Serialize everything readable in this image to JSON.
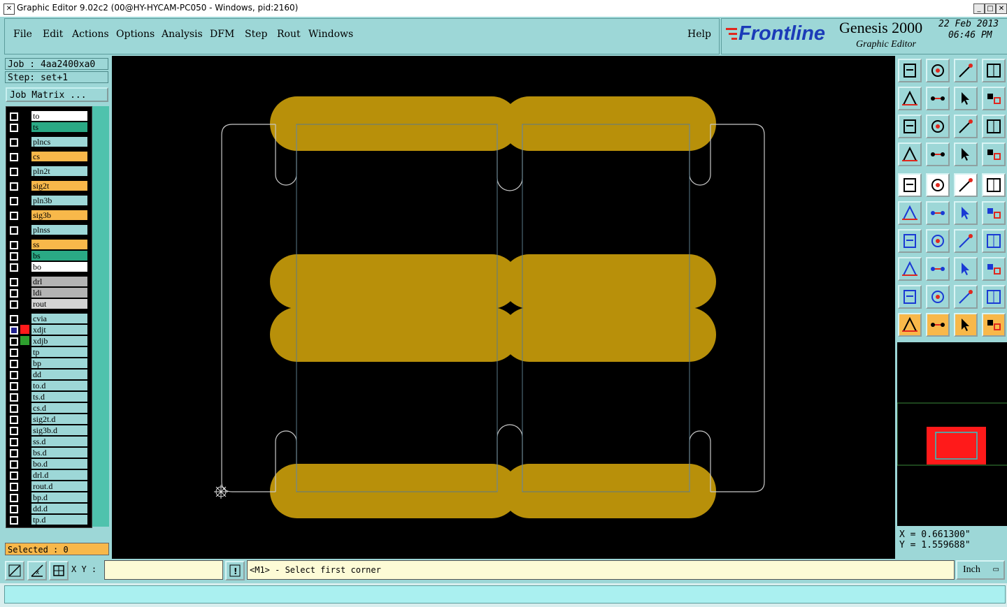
{
  "window": {
    "title": "Graphic Editor 9.02c2 (00@HY-HYCAM-PC050 - Windows, pid:2160)",
    "min": "_",
    "max": "□",
    "close": "✕"
  },
  "menu": {
    "items": [
      "File",
      "Edit",
      "Actions",
      "Options",
      "Analysis",
      "DFM",
      "Step",
      "Rout",
      "Windows"
    ],
    "help": "Help"
  },
  "brand": {
    "logo": "Frontline",
    "product": "Genesis 2000",
    "subtitle": "Graphic Editor",
    "date": "22 Feb 2013",
    "time": "06:46 PM"
  },
  "job": {
    "job_label": "Job : 4aa2400xa0",
    "step_label": "Step: set+1",
    "matrix_button": "Job Matrix ..."
  },
  "layers": [
    {
      "name": "to",
      "color": "#ffffff"
    },
    {
      "name": "ts",
      "color": "#2aa985"
    },
    {
      "name": "plncs",
      "color": "#9dd7d7"
    },
    {
      "name": "cs",
      "color": "#f8b84a"
    },
    {
      "name": "pln2t",
      "color": "#9dd7d7"
    },
    {
      "name": "sig2t",
      "color": "#f8b84a"
    },
    {
      "name": "pln3b",
      "color": "#9dd7d7"
    },
    {
      "name": "sig3b",
      "color": "#f8b84a"
    },
    {
      "name": "plnss",
      "color": "#9dd7d7"
    },
    {
      "name": "ss",
      "color": "#f8b84a"
    },
    {
      "name": "bs",
      "color": "#2aa985"
    },
    {
      "name": "bo",
      "color": "#ffffff"
    },
    {
      "name": "drl",
      "color": "#b4b4b4"
    },
    {
      "name": "ldi",
      "color": "#b4b4b4"
    },
    {
      "name": "rout",
      "color": "#d4d4d4"
    },
    {
      "name": "cvia",
      "color": "#9dd7d7"
    },
    {
      "name": "xdjt",
      "color": "#9dd7d7"
    },
    {
      "name": "xdjb",
      "color": "#9dd7d7"
    },
    {
      "name": "tp",
      "color": "#9dd7d7"
    },
    {
      "name": "bp",
      "color": "#9dd7d7"
    },
    {
      "name": "dd",
      "color": "#9dd7d7"
    },
    {
      "name": "to.d",
      "color": "#9dd7d7"
    },
    {
      "name": "ts.d",
      "color": "#9dd7d7"
    },
    {
      "name": "cs.d",
      "color": "#9dd7d7"
    },
    {
      "name": "sig2t.d",
      "color": "#9dd7d7"
    },
    {
      "name": "sig3b.d",
      "color": "#9dd7d7"
    },
    {
      "name": "ss.d",
      "color": "#9dd7d7"
    },
    {
      "name": "bs.d",
      "color": "#9dd7d7"
    },
    {
      "name": "bo.d",
      "color": "#9dd7d7"
    },
    {
      "name": "drl.d",
      "color": "#9dd7d7"
    },
    {
      "name": "rout.d",
      "color": "#9dd7d7"
    },
    {
      "name": "bp.d",
      "color": "#9dd7d7"
    },
    {
      "name": "dd.d",
      "color": "#9dd7d7"
    },
    {
      "name": "tp.d",
      "color": "#9dd7d7"
    }
  ],
  "selected": "Selected : 0",
  "coords": {
    "x": "X = 0.661300\"",
    "y": "Y = 1.559688\""
  },
  "bottom": {
    "xy_label": "X Y :",
    "xy_value": "",
    "prompt": "<M1> - Select first corner",
    "unit": "Inch"
  },
  "colors": {
    "copper": "#b8900a",
    "accent": "#9dd7d7",
    "highlight": "#f8b84a"
  },
  "toolbar_icons": [
    "zoom-in-icon",
    "zoom-out-icon",
    "home-icon",
    "window-icon",
    "pan-left-icon",
    "pan-right-icon",
    "undo-view-icon",
    "redraw-icon",
    "fit-icon",
    "center-icon",
    "scale-icon",
    "help-icon",
    "settings-icon",
    "grid-icon",
    "snap-icon",
    "snap2-icon",
    "pad-icon",
    "edit-icon",
    "measure-icon",
    "dot-icon",
    "join-icon",
    "cross-icon",
    "line-icon",
    "arrow-icon",
    "angle-icon",
    "slash-icon",
    "arc-icon",
    "mirror-icon",
    "move-icon",
    "break-icon",
    "span-icon",
    "shapes-icon",
    "tri-icon",
    "peak-icon",
    "a-icon",
    "a-line-icon",
    "select-icon",
    "select2-icon",
    "select3-icon",
    "route-icon"
  ]
}
